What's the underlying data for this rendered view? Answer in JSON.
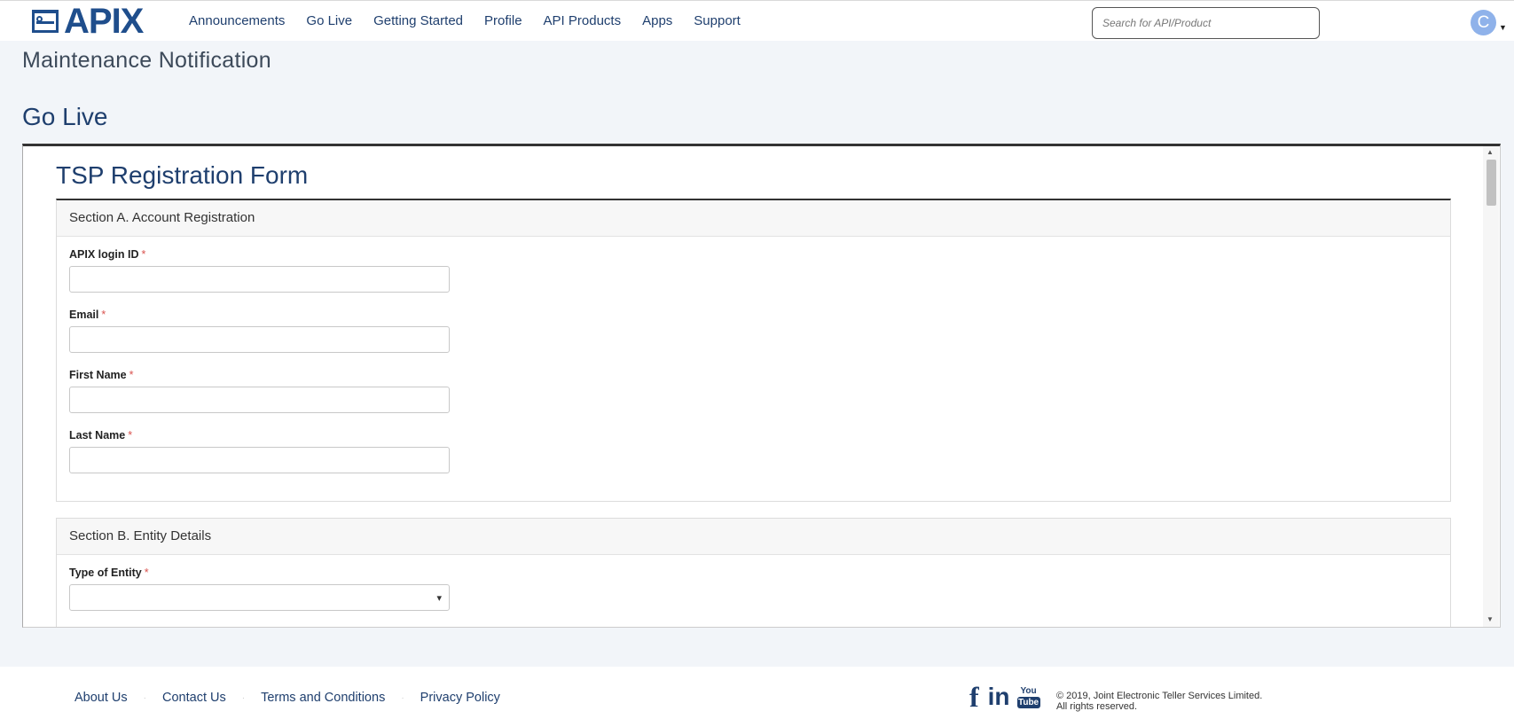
{
  "header": {
    "logo_text": "APIX",
    "nav": [
      "Announcements",
      "Go Live",
      "Getting Started",
      "Profile",
      "API Products",
      "Apps",
      "Support"
    ],
    "search_placeholder": "Search for API/Product",
    "avatar_initial": "C"
  },
  "page": {
    "maintenance_title": "Maintenance Notification",
    "section_title": "Go Live"
  },
  "form": {
    "title": "TSP Registration Form",
    "section_a": {
      "header": "Section A. Account Registration",
      "fields": [
        {
          "label": "APIX login ID",
          "value": ""
        },
        {
          "label": "Email",
          "value": ""
        },
        {
          "label": "First Name",
          "value": ""
        },
        {
          "label": "Last Name",
          "value": ""
        }
      ]
    },
    "section_b": {
      "header": "Section B. Entity Details",
      "fields": [
        {
          "label": "Type of Entity",
          "value": ""
        }
      ]
    },
    "required_mark": "*"
  },
  "footer": {
    "links": [
      "About Us",
      "Contact Us",
      "Terms and Conditions",
      "Privacy Policy"
    ],
    "separator": "·",
    "social": {
      "facebook": "f",
      "linkedin": "in",
      "youtube_top": "You",
      "youtube_bottom": "Tube"
    },
    "copyright_line1": "© 2019, Joint Electronic Teller Services Limited.",
    "copyright_line2": "All rights reserved."
  },
  "colors": {
    "brand": "#1f4e8c",
    "nav_text": "#1f3f6e",
    "page_bg": "#f2f5f9",
    "required": "#d9534f"
  }
}
